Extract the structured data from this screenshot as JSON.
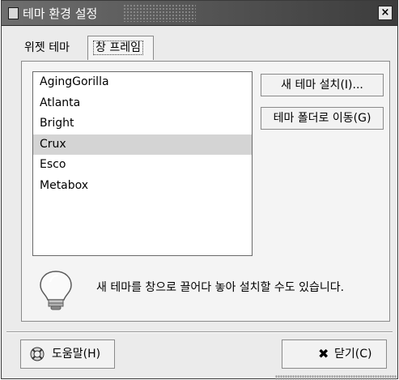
{
  "window": {
    "title": "테마 환경 설정",
    "close_glyph": "×"
  },
  "tabs": [
    {
      "label": "위젯 테마",
      "active": false
    },
    {
      "label": "창 프레임",
      "active": true
    }
  ],
  "theme_list": {
    "items": [
      "AgingGorilla",
      "Atlanta",
      "Bright",
      "Crux",
      "Esco",
      "Metabox"
    ],
    "selected": "Crux"
  },
  "buttons": {
    "install": "새 테마 설치(I)...",
    "open_folder": "테마 폴더로 이동(G)",
    "help": "도움말(H)",
    "close": "닫기(C)"
  },
  "hint": {
    "text": "새 테마를 창으로 끌어다 놓아 설치할 수도 있습니다.",
    "icon": "lightbulb-icon"
  },
  "icons": {
    "help": "lifebuoy-icon",
    "close": "x-icon",
    "close_glyph": "✖"
  }
}
